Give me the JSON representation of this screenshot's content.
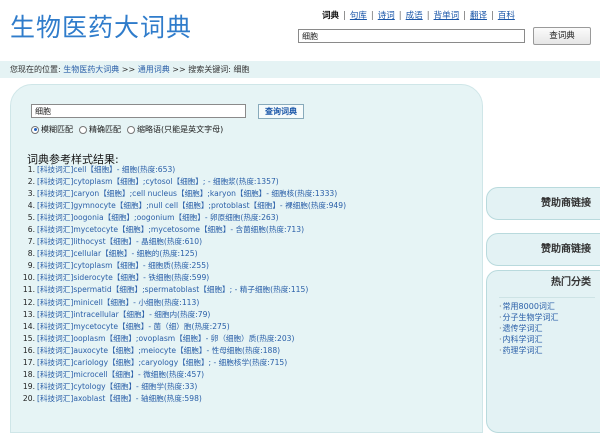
{
  "header": {
    "logo": "生物医药大词典",
    "nav": [
      "词典",
      "句库",
      "诗词",
      "成语",
      "背单词",
      "翻译",
      "百科"
    ],
    "search_value": "细胞",
    "search_button": "查词典"
  },
  "breadcrumb": {
    "prefix": "您现在的位置:",
    "site": "生物医药大词典",
    "sep1": ">>",
    "section": "通用词典",
    "sep2": ">>",
    "keyword_label": "搜索关键词: 细胞"
  },
  "search": {
    "value": "细胞",
    "button": "查询词典",
    "options": [
      {
        "label": "模糊匹配",
        "checked": true
      },
      {
        "label": "精确匹配",
        "checked": false
      },
      {
        "label": "缩略语(只能是英文字母)",
        "checked": false
      }
    ]
  },
  "results_title": "词典参考样式结果:",
  "results": [
    {
      "n": "1.",
      "cat": "[科技词汇]",
      "text": "cell【细胞】- 细胞(热度:653)"
    },
    {
      "n": "2.",
      "cat": "[科技词汇]",
      "text": "cytoplasm【细胞】;cytosol【细胞】; - 细胞浆(热度:1357)"
    },
    {
      "n": "3.",
      "cat": "[科技词汇]",
      "text": "caryon【细胞】;cell nucleus【细胞】;karyon【细胞】- 细胞核(热度:1333)"
    },
    {
      "n": "4.",
      "cat": "[科技词汇]",
      "text": "gymnocyte【细胞】;null cell【细胞】;protoblast【细胞】- 裸细胞(热度:949)"
    },
    {
      "n": "5.",
      "cat": "[科技词汇]",
      "text": "oogonia【细胞】;oogonium【细胞】- 卵原细胞(热度:263)"
    },
    {
      "n": "6.",
      "cat": "[科技词汇]",
      "text": "mycetocyte【细胞】;mycetosome【细胞】- 含菌细胞(热度:713)"
    },
    {
      "n": "7.",
      "cat": "[科技词汇]",
      "text": "lithocyst【细胞】- 晶细胞(热度:610)"
    },
    {
      "n": "8.",
      "cat": "[科技词汇]",
      "text": "cellular【细胞】- 细胞的(热度:125)"
    },
    {
      "n": "9.",
      "cat": "[科技词汇]",
      "text": "cytoplasm【细胞】- 细胞质(热度:255)"
    },
    {
      "n": "10.",
      "cat": "[科技词汇]",
      "text": "siderocyte【细胞】- 铁细胞(热度:599)"
    },
    {
      "n": "11.",
      "cat": "[科技词汇]",
      "text": "spermatid【细胞】;spermatoblast【细胞】; - 精子细胞(热度:115)"
    },
    {
      "n": "12.",
      "cat": "[科技词汇]",
      "text": "minicell【细胞】- 小细胞(热度:113)"
    },
    {
      "n": "13.",
      "cat": "[科技词汇]",
      "text": "intracellular【细胞】- 细胞内(热度:79)"
    },
    {
      "n": "14.",
      "cat": "[科技词汇]",
      "text": "mycetocyte【细胞】- 菌（细）胞(热度:275)"
    },
    {
      "n": "15.",
      "cat": "[科技词汇]",
      "text": "ooplasm【细胞】;ovoplasm【细胞】- 卵（细胞）质(热度:203)"
    },
    {
      "n": "16.",
      "cat": "[科技词汇]",
      "text": "auxocyte【细胞】;meiocyte【细胞】- 性母细胞(热度:188)"
    },
    {
      "n": "17.",
      "cat": "[科技词汇]",
      "text": "cariology【细胞】;caryology【细胞】; - 细胞核学(热度:715)"
    },
    {
      "n": "18.",
      "cat": "[科技词汇]",
      "text": "microcell【细胞】- 微细胞(热度:457)"
    },
    {
      "n": "19.",
      "cat": "[科技词汇]",
      "text": "cytology【细胞】- 细胞学(热度:33)"
    },
    {
      "n": "20.",
      "cat": "[科技词汇]",
      "text": "axoblast【细胞】- 轴细胞(热度:598)"
    }
  ],
  "sidebar": {
    "sponsor1": "赞助商链接",
    "sponsor2": "赞助商链接",
    "hot_title": "热门分类",
    "hot_items": [
      "常用8000词汇",
      "分子生物学词汇",
      "遗传学词汇",
      "内科学词汇",
      "药理学词汇"
    ]
  }
}
